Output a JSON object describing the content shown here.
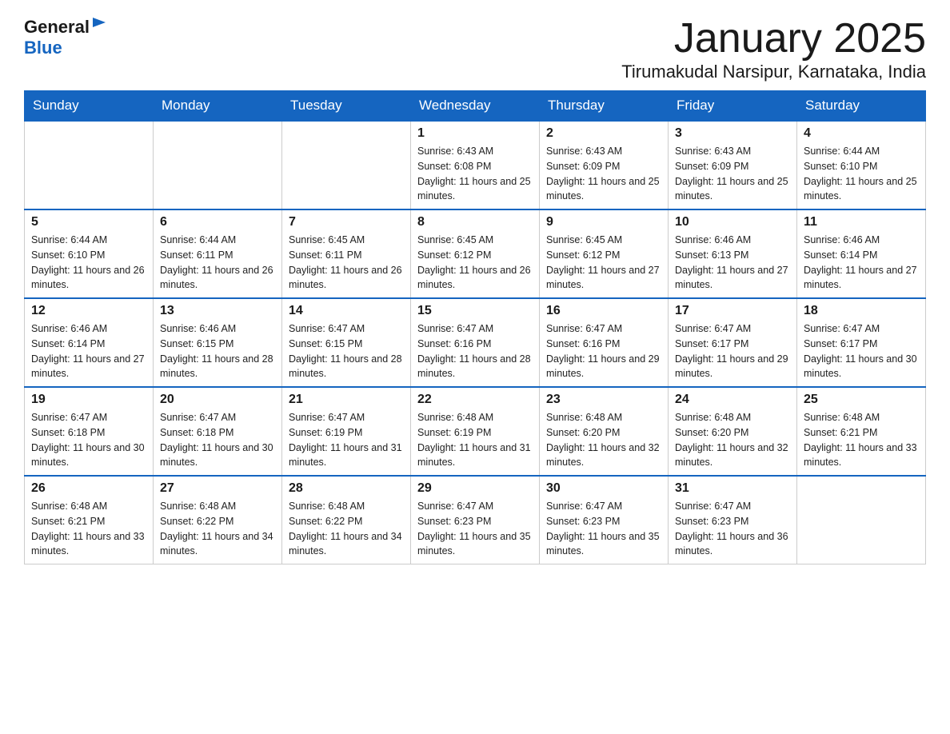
{
  "logo": {
    "general": "General",
    "blue": "Blue",
    "arrow": "▶"
  },
  "header": {
    "month": "January 2025",
    "location": "Tirumakudal Narsipur, Karnataka, India"
  },
  "weekdays": [
    "Sunday",
    "Monday",
    "Tuesday",
    "Wednesday",
    "Thursday",
    "Friday",
    "Saturday"
  ],
  "weeks": [
    [
      {
        "day": "",
        "info": ""
      },
      {
        "day": "",
        "info": ""
      },
      {
        "day": "",
        "info": ""
      },
      {
        "day": "1",
        "info": "Sunrise: 6:43 AM\nSunset: 6:08 PM\nDaylight: 11 hours and 25 minutes."
      },
      {
        "day": "2",
        "info": "Sunrise: 6:43 AM\nSunset: 6:09 PM\nDaylight: 11 hours and 25 minutes."
      },
      {
        "day": "3",
        "info": "Sunrise: 6:43 AM\nSunset: 6:09 PM\nDaylight: 11 hours and 25 minutes."
      },
      {
        "day": "4",
        "info": "Sunrise: 6:44 AM\nSunset: 6:10 PM\nDaylight: 11 hours and 25 minutes."
      }
    ],
    [
      {
        "day": "5",
        "info": "Sunrise: 6:44 AM\nSunset: 6:10 PM\nDaylight: 11 hours and 26 minutes."
      },
      {
        "day": "6",
        "info": "Sunrise: 6:44 AM\nSunset: 6:11 PM\nDaylight: 11 hours and 26 minutes."
      },
      {
        "day": "7",
        "info": "Sunrise: 6:45 AM\nSunset: 6:11 PM\nDaylight: 11 hours and 26 minutes."
      },
      {
        "day": "8",
        "info": "Sunrise: 6:45 AM\nSunset: 6:12 PM\nDaylight: 11 hours and 26 minutes."
      },
      {
        "day": "9",
        "info": "Sunrise: 6:45 AM\nSunset: 6:12 PM\nDaylight: 11 hours and 27 minutes."
      },
      {
        "day": "10",
        "info": "Sunrise: 6:46 AM\nSunset: 6:13 PM\nDaylight: 11 hours and 27 minutes."
      },
      {
        "day": "11",
        "info": "Sunrise: 6:46 AM\nSunset: 6:14 PM\nDaylight: 11 hours and 27 minutes."
      }
    ],
    [
      {
        "day": "12",
        "info": "Sunrise: 6:46 AM\nSunset: 6:14 PM\nDaylight: 11 hours and 27 minutes."
      },
      {
        "day": "13",
        "info": "Sunrise: 6:46 AM\nSunset: 6:15 PM\nDaylight: 11 hours and 28 minutes."
      },
      {
        "day": "14",
        "info": "Sunrise: 6:47 AM\nSunset: 6:15 PM\nDaylight: 11 hours and 28 minutes."
      },
      {
        "day": "15",
        "info": "Sunrise: 6:47 AM\nSunset: 6:16 PM\nDaylight: 11 hours and 28 minutes."
      },
      {
        "day": "16",
        "info": "Sunrise: 6:47 AM\nSunset: 6:16 PM\nDaylight: 11 hours and 29 minutes."
      },
      {
        "day": "17",
        "info": "Sunrise: 6:47 AM\nSunset: 6:17 PM\nDaylight: 11 hours and 29 minutes."
      },
      {
        "day": "18",
        "info": "Sunrise: 6:47 AM\nSunset: 6:17 PM\nDaylight: 11 hours and 30 minutes."
      }
    ],
    [
      {
        "day": "19",
        "info": "Sunrise: 6:47 AM\nSunset: 6:18 PM\nDaylight: 11 hours and 30 minutes."
      },
      {
        "day": "20",
        "info": "Sunrise: 6:47 AM\nSunset: 6:18 PM\nDaylight: 11 hours and 30 minutes."
      },
      {
        "day": "21",
        "info": "Sunrise: 6:47 AM\nSunset: 6:19 PM\nDaylight: 11 hours and 31 minutes."
      },
      {
        "day": "22",
        "info": "Sunrise: 6:48 AM\nSunset: 6:19 PM\nDaylight: 11 hours and 31 minutes."
      },
      {
        "day": "23",
        "info": "Sunrise: 6:48 AM\nSunset: 6:20 PM\nDaylight: 11 hours and 32 minutes."
      },
      {
        "day": "24",
        "info": "Sunrise: 6:48 AM\nSunset: 6:20 PM\nDaylight: 11 hours and 32 minutes."
      },
      {
        "day": "25",
        "info": "Sunrise: 6:48 AM\nSunset: 6:21 PM\nDaylight: 11 hours and 33 minutes."
      }
    ],
    [
      {
        "day": "26",
        "info": "Sunrise: 6:48 AM\nSunset: 6:21 PM\nDaylight: 11 hours and 33 minutes."
      },
      {
        "day": "27",
        "info": "Sunrise: 6:48 AM\nSunset: 6:22 PM\nDaylight: 11 hours and 34 minutes."
      },
      {
        "day": "28",
        "info": "Sunrise: 6:48 AM\nSunset: 6:22 PM\nDaylight: 11 hours and 34 minutes."
      },
      {
        "day": "29",
        "info": "Sunrise: 6:47 AM\nSunset: 6:23 PM\nDaylight: 11 hours and 35 minutes."
      },
      {
        "day": "30",
        "info": "Sunrise: 6:47 AM\nSunset: 6:23 PM\nDaylight: 11 hours and 35 minutes."
      },
      {
        "day": "31",
        "info": "Sunrise: 6:47 AM\nSunset: 6:23 PM\nDaylight: 11 hours and 36 minutes."
      },
      {
        "day": "",
        "info": ""
      }
    ]
  ]
}
